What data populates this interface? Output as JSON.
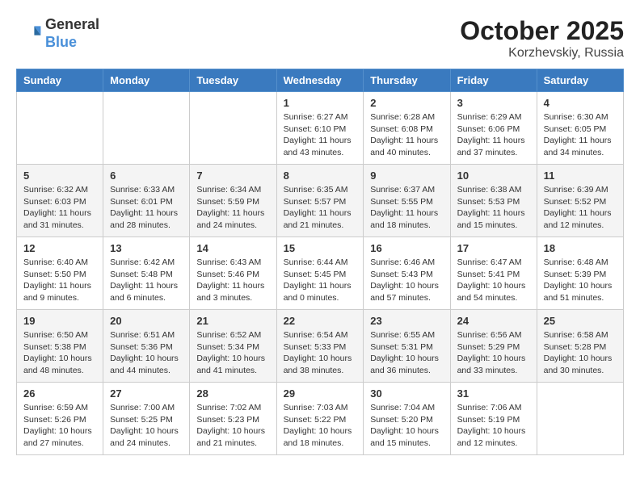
{
  "logo": {
    "general": "General",
    "blue": "Blue"
  },
  "title": "October 2025",
  "subtitle": "Korzhevskiy, Russia",
  "weekdays": [
    "Sunday",
    "Monday",
    "Tuesday",
    "Wednesday",
    "Thursday",
    "Friday",
    "Saturday"
  ],
  "weeks": [
    [
      {
        "day": "",
        "info": ""
      },
      {
        "day": "",
        "info": ""
      },
      {
        "day": "",
        "info": ""
      },
      {
        "day": "1",
        "info": "Sunrise: 6:27 AM\nSunset: 6:10 PM\nDaylight: 11 hours and 43 minutes."
      },
      {
        "day": "2",
        "info": "Sunrise: 6:28 AM\nSunset: 6:08 PM\nDaylight: 11 hours and 40 minutes."
      },
      {
        "day": "3",
        "info": "Sunrise: 6:29 AM\nSunset: 6:06 PM\nDaylight: 11 hours and 37 minutes."
      },
      {
        "day": "4",
        "info": "Sunrise: 6:30 AM\nSunset: 6:05 PM\nDaylight: 11 hours and 34 minutes."
      }
    ],
    [
      {
        "day": "5",
        "info": "Sunrise: 6:32 AM\nSunset: 6:03 PM\nDaylight: 11 hours and 31 minutes."
      },
      {
        "day": "6",
        "info": "Sunrise: 6:33 AM\nSunset: 6:01 PM\nDaylight: 11 hours and 28 minutes."
      },
      {
        "day": "7",
        "info": "Sunrise: 6:34 AM\nSunset: 5:59 PM\nDaylight: 11 hours and 24 minutes."
      },
      {
        "day": "8",
        "info": "Sunrise: 6:35 AM\nSunset: 5:57 PM\nDaylight: 11 hours and 21 minutes."
      },
      {
        "day": "9",
        "info": "Sunrise: 6:37 AM\nSunset: 5:55 PM\nDaylight: 11 hours and 18 minutes."
      },
      {
        "day": "10",
        "info": "Sunrise: 6:38 AM\nSunset: 5:53 PM\nDaylight: 11 hours and 15 minutes."
      },
      {
        "day": "11",
        "info": "Sunrise: 6:39 AM\nSunset: 5:52 PM\nDaylight: 11 hours and 12 minutes."
      }
    ],
    [
      {
        "day": "12",
        "info": "Sunrise: 6:40 AM\nSunset: 5:50 PM\nDaylight: 11 hours and 9 minutes."
      },
      {
        "day": "13",
        "info": "Sunrise: 6:42 AM\nSunset: 5:48 PM\nDaylight: 11 hours and 6 minutes."
      },
      {
        "day": "14",
        "info": "Sunrise: 6:43 AM\nSunset: 5:46 PM\nDaylight: 11 hours and 3 minutes."
      },
      {
        "day": "15",
        "info": "Sunrise: 6:44 AM\nSunset: 5:45 PM\nDaylight: 11 hours and 0 minutes."
      },
      {
        "day": "16",
        "info": "Sunrise: 6:46 AM\nSunset: 5:43 PM\nDaylight: 10 hours and 57 minutes."
      },
      {
        "day": "17",
        "info": "Sunrise: 6:47 AM\nSunset: 5:41 PM\nDaylight: 10 hours and 54 minutes."
      },
      {
        "day": "18",
        "info": "Sunrise: 6:48 AM\nSunset: 5:39 PM\nDaylight: 10 hours and 51 minutes."
      }
    ],
    [
      {
        "day": "19",
        "info": "Sunrise: 6:50 AM\nSunset: 5:38 PM\nDaylight: 10 hours and 48 minutes."
      },
      {
        "day": "20",
        "info": "Sunrise: 6:51 AM\nSunset: 5:36 PM\nDaylight: 10 hours and 44 minutes."
      },
      {
        "day": "21",
        "info": "Sunrise: 6:52 AM\nSunset: 5:34 PM\nDaylight: 10 hours and 41 minutes."
      },
      {
        "day": "22",
        "info": "Sunrise: 6:54 AM\nSunset: 5:33 PM\nDaylight: 10 hours and 38 minutes."
      },
      {
        "day": "23",
        "info": "Sunrise: 6:55 AM\nSunset: 5:31 PM\nDaylight: 10 hours and 36 minutes."
      },
      {
        "day": "24",
        "info": "Sunrise: 6:56 AM\nSunset: 5:29 PM\nDaylight: 10 hours and 33 minutes."
      },
      {
        "day": "25",
        "info": "Sunrise: 6:58 AM\nSunset: 5:28 PM\nDaylight: 10 hours and 30 minutes."
      }
    ],
    [
      {
        "day": "26",
        "info": "Sunrise: 6:59 AM\nSunset: 5:26 PM\nDaylight: 10 hours and 27 minutes."
      },
      {
        "day": "27",
        "info": "Sunrise: 7:00 AM\nSunset: 5:25 PM\nDaylight: 10 hours and 24 minutes."
      },
      {
        "day": "28",
        "info": "Sunrise: 7:02 AM\nSunset: 5:23 PM\nDaylight: 10 hours and 21 minutes."
      },
      {
        "day": "29",
        "info": "Sunrise: 7:03 AM\nSunset: 5:22 PM\nDaylight: 10 hours and 18 minutes."
      },
      {
        "day": "30",
        "info": "Sunrise: 7:04 AM\nSunset: 5:20 PM\nDaylight: 10 hours and 15 minutes."
      },
      {
        "day": "31",
        "info": "Sunrise: 7:06 AM\nSunset: 5:19 PM\nDaylight: 10 hours and 12 minutes."
      },
      {
        "day": "",
        "info": ""
      }
    ]
  ]
}
